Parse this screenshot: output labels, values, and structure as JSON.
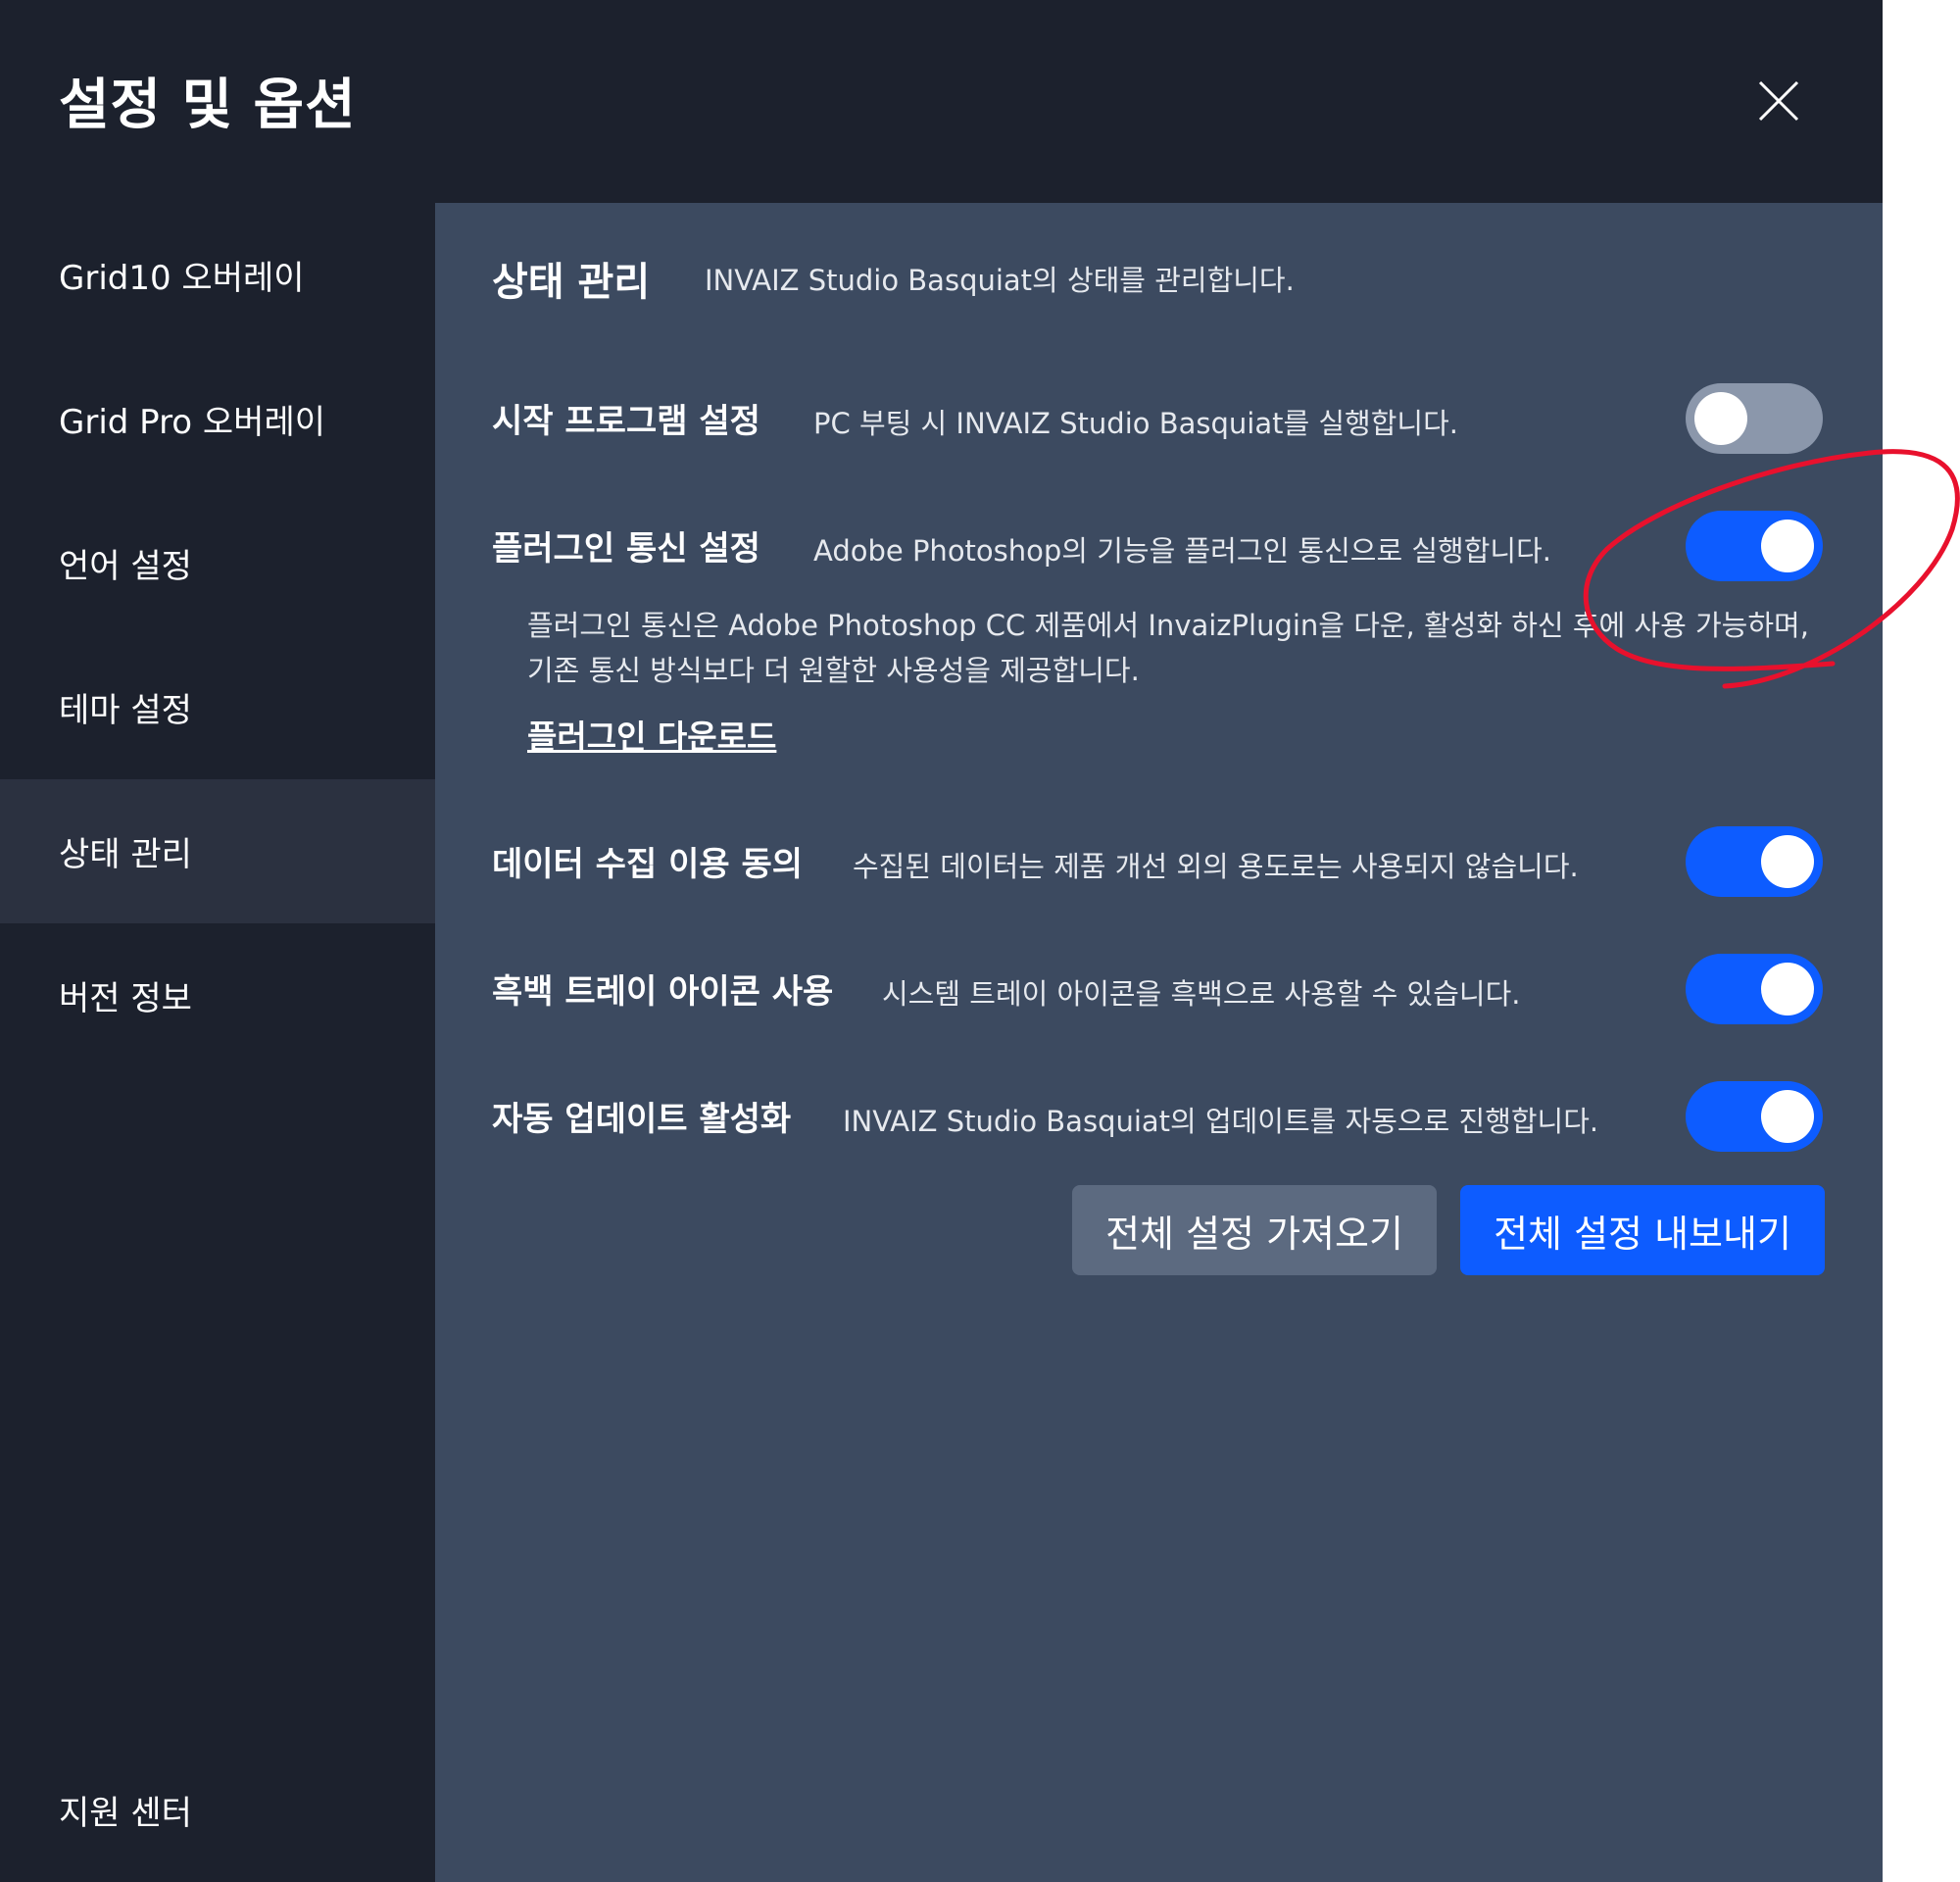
{
  "header": {
    "title": "설정 및 옵션",
    "close_icon": "close-icon"
  },
  "sidebar": {
    "items": [
      {
        "label": "Grid10 오버레이",
        "active": false
      },
      {
        "label": "Grid Pro 오버레이",
        "active": false
      },
      {
        "label": "언어 설정",
        "active": false
      },
      {
        "label": "테마 설정",
        "active": false
      },
      {
        "label": "상태 관리",
        "active": true
      },
      {
        "label": "버전 정보",
        "active": false
      }
    ],
    "footer_label": "지원 센터"
  },
  "section": {
    "title": "상태 관리",
    "description": "INVAIZ Studio Basquiat의 상태를 관리합니다."
  },
  "settings": [
    {
      "label": "시작 프로그램 설정",
      "description": "PC 부팅 시 INVAIZ Studio Basquiat를 실행합니다.",
      "enabled": false
    },
    {
      "label": "플러그인 통신 설정",
      "description": "Adobe Photoshop의 기능을 플러그인 통신으로 실행합니다.",
      "enabled": true
    },
    {
      "label": "데이터 수집 이용 동의",
      "description": "수집된 데이터는 제품 개선 외의 용도로는 사용되지 않습니다.",
      "enabled": true
    },
    {
      "label": "흑백 트레이 아이콘 사용",
      "description": "시스템 트레이 아이콘을 흑백으로 사용할 수 있습니다.",
      "enabled": true
    },
    {
      "label": "자동 업데이트 활성화",
      "description": "INVAIZ Studio Basquiat의 업데이트를 자동으로 진행합니다.",
      "enabled": true
    }
  ],
  "plugin_note": {
    "text": "플러그인 통신은 Adobe Photoshop CC 제품에서 InvaizPlugin을 다운, 활성화 하신 후에 사용 가능하며, 기존 통신 방식보다 더 원할한 사용성을 제공합니다.",
    "link_label": "플러그인 다운로드"
  },
  "buttons": {
    "import_label": "전체 설정 가져오기",
    "export_label": "전체 설정 내보내기"
  },
  "colors": {
    "background": "#1c212d",
    "panel": "#3c4a60",
    "accent": "#0d5cff",
    "toggle_off": "#8b97ab",
    "annotation": "#e8112d"
  }
}
